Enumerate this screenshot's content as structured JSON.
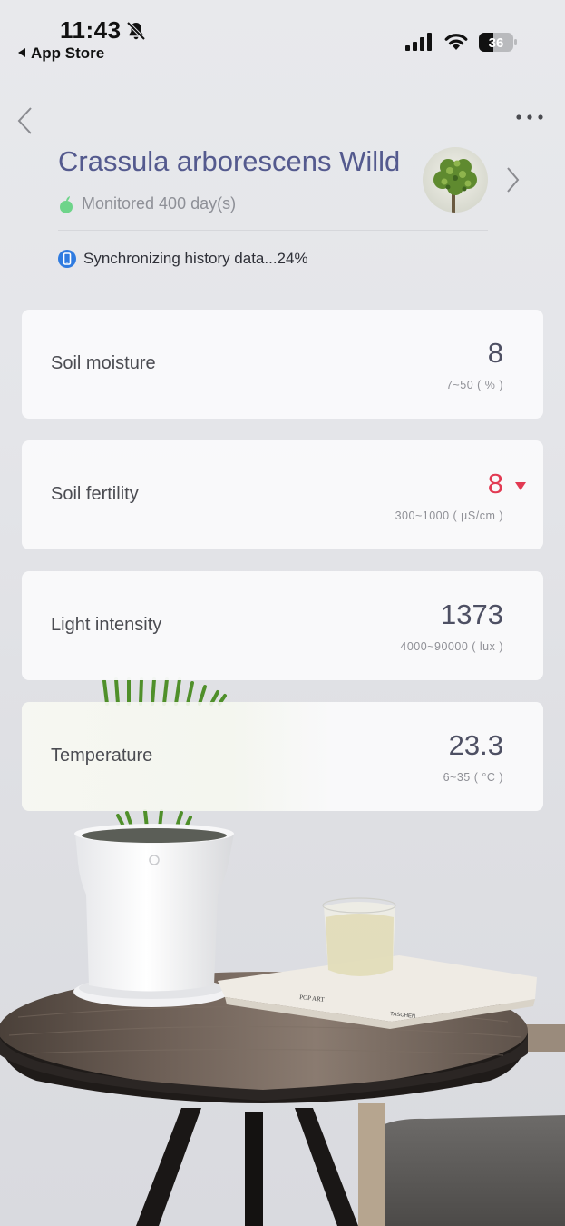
{
  "status_bar": {
    "time": "11:43",
    "back_app": "App Store",
    "battery": "36"
  },
  "header": {
    "plant_name": "Crassula arborescens Willd",
    "monitored": "Monitored 400 day(s)",
    "sync_status": "Synchronizing history data...24%"
  },
  "metrics": [
    {
      "label": "Soil moisture",
      "value": "8",
      "range": "7~50 ( % )",
      "alert": false
    },
    {
      "label": "Soil fertility",
      "value": "8",
      "range": "300~1000 ( µS/cm )",
      "alert": true
    },
    {
      "label": "Light intensity",
      "value": "1373",
      "range": "4000~90000 ( lux )",
      "alert": false
    },
    {
      "label": "Temperature",
      "value": "23.3",
      "range": "6~35 ( °C )",
      "alert": false
    }
  ],
  "scene": {
    "book_title": "POP ART",
    "book_publisher": "TASCHEN"
  },
  "colors": {
    "title": "#545a8e",
    "alert": "#e23a52",
    "accent_green": "#6ed48a",
    "sync_blue": "#2f7be0"
  }
}
